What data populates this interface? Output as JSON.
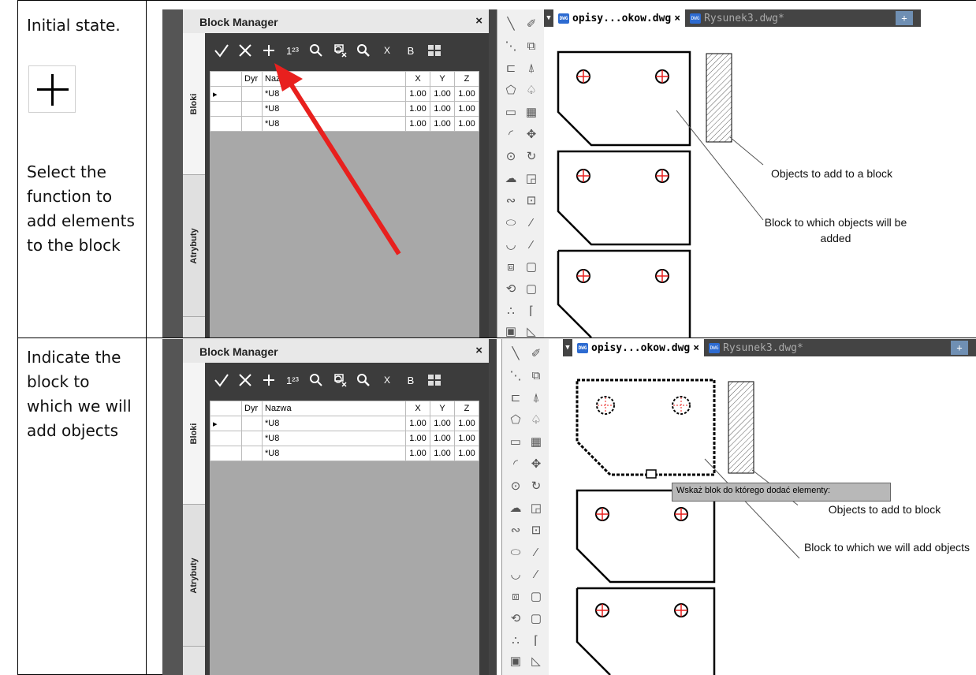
{
  "steps": [
    {
      "caption": "Initial state.",
      "caption2": "Select the function to add elements to the block",
      "dialog_title": "Block Manager",
      "close_glyph": "×",
      "tab_bloki": "Bloki",
      "tab_atrybuty": "Atrybuty",
      "file_tab_active": "opisy...okow.dwg",
      "file_tab_other": "Rysunek3.dwg*",
      "tab_close": "×",
      "note1": "Objects to add to a block",
      "note2": "Block to which objects will be added"
    },
    {
      "caption": "Indicate the block to which we will add objects",
      "dialog_title": "Block Manager",
      "close_glyph": "×",
      "tab_bloki": "Bloki",
      "tab_atrybuty": "Atrybuty",
      "file_tab_active": "opisy...okow.dwg",
      "file_tab_other": "Rysunek3.dwg*",
      "tab_close": "×",
      "tooltip": "Wskaż blok do którego dodać elementy:",
      "note1": "Objects to add to block",
      "note2": "Block to which we will add objects"
    }
  ],
  "toolbar": {
    "accept": "check-icon",
    "cancel": "x-icon",
    "add": "plus-icon",
    "numbering": "1²³",
    "search": "magnifier-icon",
    "remove_objects": "remove-objects-icon",
    "find": "find-icon",
    "scale_label": "X",
    "bl_label": "B",
    "grid": "grid-icon"
  },
  "table": {
    "headers": [
      "",
      "Dyr",
      "Nazwa",
      "X",
      "Y",
      "Z"
    ],
    "rows": [
      {
        "marker": "▸",
        "name": "*U8",
        "x": "1.00",
        "y": "1.00",
        "z": "1.00"
      },
      {
        "marker": "",
        "name": "*U8",
        "x": "1.00",
        "y": "1.00",
        "z": "1.00"
      },
      {
        "marker": "",
        "name": "*U8",
        "x": "1.00",
        "y": "1.00",
        "z": "1.00"
      }
    ]
  },
  "colors": {
    "panel": "#3c3c3c",
    "arrow": "#e8201e",
    "hole": "#e8201e",
    "tab_active": "#ffffff"
  }
}
